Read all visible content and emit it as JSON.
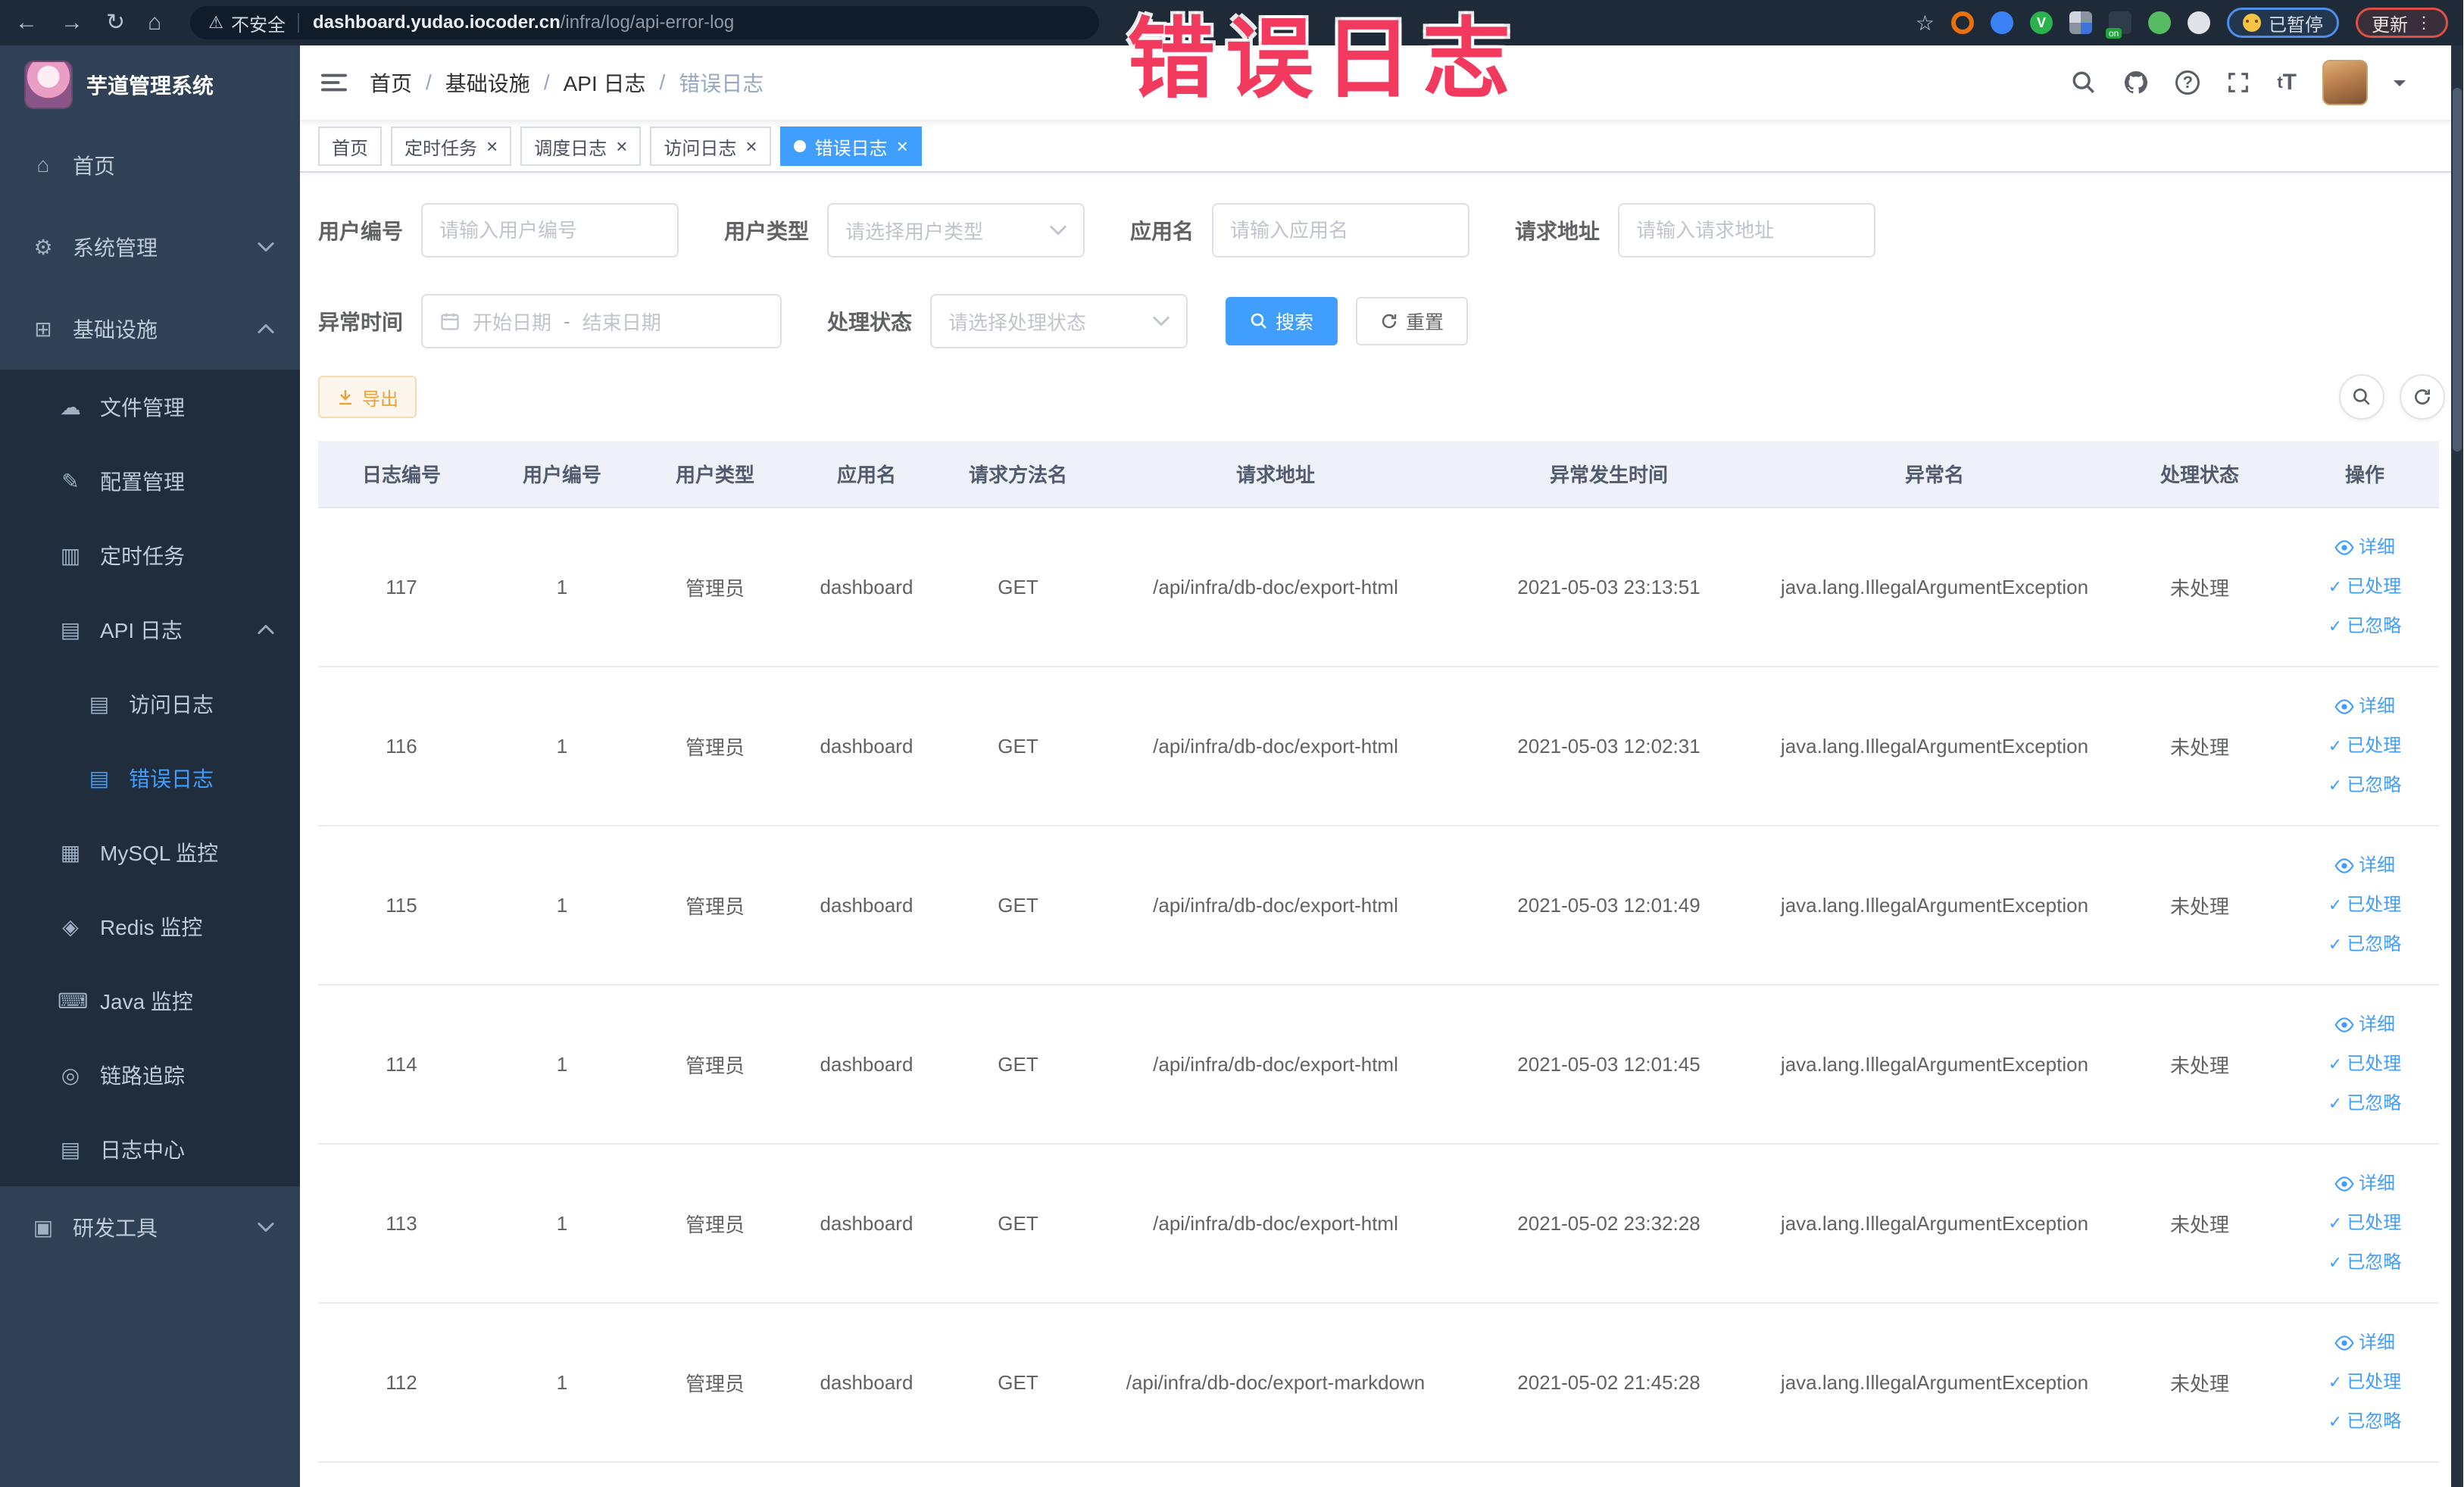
{
  "annotation": {
    "text": "错误日志",
    "color": "#f23a5f"
  },
  "browser": {
    "nav_icons": [
      "back-icon",
      "forward-icon",
      "reload-icon",
      "home-icon"
    ],
    "security_label": "不安全",
    "url_domain": "dashboard.yudao.iocoder.cn",
    "url_path": "/infra/log/api-error-log",
    "bookmark_icon": "star-icon",
    "extensions": [
      {
        "name": "ext-orange-ring-icon",
        "color": "#e8710a",
        "style": "ring"
      },
      {
        "name": "ext-blue-shield-icon",
        "color": "#3b82f6",
        "style": "circle"
      },
      {
        "name": "ext-green-v-icon",
        "color": "#2bb24c",
        "style": "circle",
        "glyph": "V"
      },
      {
        "name": "ext-grid-icon",
        "color": "#8a94a0",
        "style": "grid"
      },
      {
        "name": "ext-on-badge-icon",
        "color": "#2f3c4a",
        "style": "square",
        "badge": "on"
      },
      {
        "name": "ext-green-leaf-icon",
        "color": "#57bb63",
        "style": "circle"
      },
      {
        "name": "ext-puzzle-icon",
        "color": "#dfe3e8",
        "style": "circle"
      }
    ],
    "paused_label": "已暂停",
    "update_label": "更新"
  },
  "sidebar": {
    "app_title": "芋道管理系统",
    "items": [
      {
        "name": "home",
        "label": "首页",
        "icon": "home-icon",
        "glyph": "⌂",
        "level": 1
      },
      {
        "name": "system-management",
        "label": "系统管理",
        "icon": "gear-icon",
        "glyph": "⚙",
        "level": 1,
        "chevron": "down"
      },
      {
        "name": "infrastructure",
        "label": "基础设施",
        "icon": "infrastructure-icon",
        "glyph": "⊞",
        "level": 1,
        "chevron": "up"
      },
      {
        "name": "file-management",
        "label": "文件管理",
        "icon": "cloud-upload-icon",
        "glyph": "☁",
        "level": 2
      },
      {
        "name": "config-management",
        "label": "配置管理",
        "icon": "edit-icon",
        "glyph": "✎",
        "level": 2
      },
      {
        "name": "scheduled-tasks",
        "label": "定时任务",
        "icon": "task-list-icon",
        "glyph": "▥",
        "level": 2
      },
      {
        "name": "api-log",
        "label": "API 日志",
        "icon": "api-log-icon",
        "glyph": "▤",
        "level": 2,
        "chevron": "up"
      },
      {
        "name": "access-log",
        "label": "访问日志",
        "icon": "access-log-icon",
        "glyph": "▤",
        "level": 3
      },
      {
        "name": "error-log",
        "label": "错误日志",
        "icon": "error-log-icon",
        "glyph": "▤",
        "level": 3,
        "active": true
      },
      {
        "name": "mysql-monitor",
        "label": "MySQL 监控",
        "icon": "mysql-icon",
        "glyph": "▦",
        "level": 2
      },
      {
        "name": "redis-monitor",
        "label": "Redis 监控",
        "icon": "redis-icon",
        "glyph": "◈",
        "level": 2
      },
      {
        "name": "java-monitor",
        "label": "Java 监控",
        "icon": "java-icon",
        "glyph": "⌨",
        "level": 2
      },
      {
        "name": "trace",
        "label": "链路追踪",
        "icon": "trace-eye-icon",
        "glyph": "◎",
        "level": 2
      },
      {
        "name": "log-center",
        "label": "日志中心",
        "icon": "log-center-icon",
        "glyph": "▤",
        "level": 2
      },
      {
        "name": "dev-tools",
        "label": "研发工具",
        "icon": "toolbox-icon",
        "glyph": "▣",
        "level": 1,
        "chevron": "down"
      }
    ]
  },
  "navbar": {
    "breadcrumb": [
      "首页",
      "基础设施",
      "API 日志",
      "错误日志"
    ],
    "right_icons": [
      "search-icon",
      "github-icon",
      "help-icon",
      "fullscreen-icon",
      "font-size-icon",
      "user-avatar",
      "caret-down-icon"
    ],
    "font_size_icon_text": "tT",
    "help_icon_text": "?"
  },
  "tabs": [
    {
      "name": "home",
      "label": "首页",
      "closable": false,
      "active": false
    },
    {
      "name": "scheduled-tasks",
      "label": "定时任务",
      "closable": true,
      "active": false
    },
    {
      "name": "schedule-log",
      "label": "调度日志",
      "closable": true,
      "active": false
    },
    {
      "name": "access-log",
      "label": "访问日志",
      "closable": true,
      "active": false
    },
    {
      "name": "error-log",
      "label": "错误日志",
      "closable": true,
      "active": true
    }
  ],
  "filters": {
    "user_id": {
      "label": "用户编号",
      "placeholder": "请输入用户编号",
      "value": ""
    },
    "user_type": {
      "label": "用户类型",
      "placeholder": "请选择用户类型",
      "value": ""
    },
    "app_name": {
      "label": "应用名",
      "placeholder": "请输入应用名",
      "value": ""
    },
    "req_url": {
      "label": "请求地址",
      "placeholder": "请输入请求地址",
      "value": ""
    },
    "time": {
      "label": "异常时间",
      "start_placeholder": "开始日期",
      "separator": "-",
      "end_placeholder": "结束日期"
    },
    "status": {
      "label": "处理状态",
      "placeholder": "请选择处理状态",
      "value": ""
    },
    "search_label": "搜索",
    "reset_label": "重置"
  },
  "toolbar": {
    "export_label": "导出"
  },
  "table": {
    "columns": [
      "日志编号",
      "用户编号",
      "用户类型",
      "应用名",
      "请求方法名",
      "请求地址",
      "异常发生时间",
      "异常名",
      "处理状态",
      "操作"
    ],
    "rows": [
      {
        "cells": [
          "117",
          "1",
          "管理员",
          "dashboard",
          "GET",
          "/api/infra/db-doc/export-html",
          "2021-05-03 23:13:51",
          "java.lang.IllegalArgumentException",
          "未处理"
        ]
      },
      {
        "cells": [
          "116",
          "1",
          "管理员",
          "dashboard",
          "GET",
          "/api/infra/db-doc/export-html",
          "2021-05-03 12:02:31",
          "java.lang.IllegalArgumentException",
          "未处理"
        ]
      },
      {
        "cells": [
          "115",
          "1",
          "管理员",
          "dashboard",
          "GET",
          "/api/infra/db-doc/export-html",
          "2021-05-03 12:01:49",
          "java.lang.IllegalArgumentException",
          "未处理"
        ]
      },
      {
        "cells": [
          "114",
          "1",
          "管理员",
          "dashboard",
          "GET",
          "/api/infra/db-doc/export-html",
          "2021-05-03 12:01:45",
          "java.lang.IllegalArgumentException",
          "未处理"
        ]
      },
      {
        "cells": [
          "113",
          "1",
          "管理员",
          "dashboard",
          "GET",
          "/api/infra/db-doc/export-html",
          "2021-05-02 23:32:28",
          "java.lang.IllegalArgumentException",
          "未处理"
        ]
      },
      {
        "cells": [
          "112",
          "1",
          "管理员",
          "dashboard",
          "GET",
          "/api/infra/db-doc/export-markdown",
          "2021-05-02 21:45:28",
          "java.lang.IllegalArgumentException",
          "未处理"
        ]
      }
    ],
    "row_actions": [
      {
        "name": "view-detail-link",
        "icon": "eye-icon",
        "label": "详细"
      },
      {
        "name": "mark-processed-link",
        "icon": "check-icon",
        "label": "已处理"
      },
      {
        "name": "mark-ignored-link",
        "icon": "check-icon",
        "label": "已忽略"
      }
    ]
  },
  "colors": {
    "accent": "#409EFF",
    "sidebar_bg": "#304156",
    "submenu_bg": "#1f2d3d",
    "annotation": "#f23a5f",
    "export_warning": "#e6a23c",
    "table_header_bg": "#eef1f7"
  }
}
